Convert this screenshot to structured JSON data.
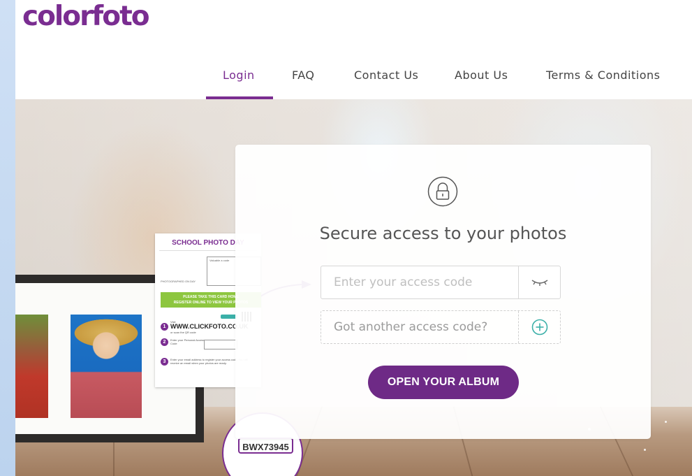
{
  "brand": {
    "logo_text": "colorfoto",
    "color": "#7a2d91"
  },
  "nav": {
    "items": [
      {
        "label": "Login",
        "active": true
      },
      {
        "label": "FAQ",
        "active": false
      },
      {
        "label": "Contact Us",
        "active": false
      },
      {
        "label": "About Us",
        "active": false
      },
      {
        "label": "Terms & Conditions",
        "active": false
      }
    ]
  },
  "login": {
    "lock_icon": "lock-icon",
    "title": "Secure access to your photos",
    "access_code": {
      "value": "",
      "placeholder": "Enter your access code",
      "toggle_icon": "eye-closed-icon"
    },
    "another_code": {
      "label": "Got another access code?",
      "icon": "plus-circle-icon"
    },
    "submit_label": "OPEN YOUR ALBUM",
    "accent": "#6e2a86",
    "icon_color": "#3bb0a8"
  },
  "card": {
    "title": "SCHOOL PHOTO DAY",
    "box_label": "Valuable a code",
    "photographed_label": "PHOTOGRAPHED ON DAY",
    "green_banner_line1": "PLEASE TAKE THIS CARD HOME",
    "green_banner_line2": "REGISTER ONLINE TO VIEW YOUR PHOTOS",
    "step1": "1",
    "visit_label": "Visit",
    "url": "WWW.CLICKFOTO.CO.UK",
    "url_sub": "or scan the QR code",
    "step2": "2",
    "step2_label": "Enter your Personal Access Code",
    "step3": "3",
    "step3_label": "Enter your email address to register your access code. You will receive an email when your photos are ready.",
    "access_code": "BWX73945"
  }
}
